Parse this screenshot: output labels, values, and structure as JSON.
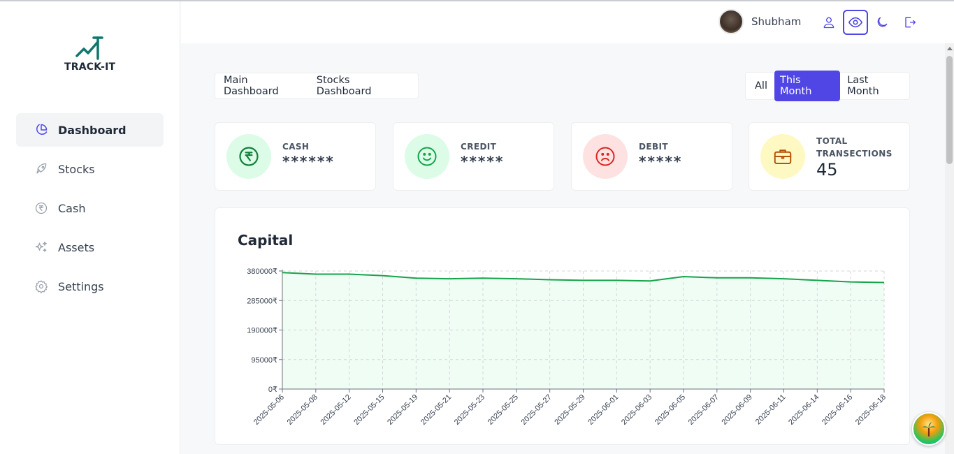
{
  "app": {
    "logo_text": "TRACK-IT"
  },
  "sidebar": {
    "items": [
      {
        "label": "Dashboard",
        "icon": "pie-chart-icon",
        "active": true
      },
      {
        "label": "Stocks",
        "icon": "rocket-icon",
        "active": false
      },
      {
        "label": "Cash",
        "icon": "rupee-circle-icon",
        "active": false
      },
      {
        "label": "Assets",
        "icon": "sparkles-icon",
        "active": false
      },
      {
        "label": "Settings",
        "icon": "gear-icon",
        "active": false
      }
    ]
  },
  "header": {
    "username": "Shubham",
    "icons": [
      "user-icon",
      "eye-icon",
      "moon-icon",
      "logout-icon"
    ]
  },
  "dashboard_tabs": [
    "Main Dashboard",
    "Stocks Dashboard"
  ],
  "period_filters": {
    "options": [
      "All",
      "This Month",
      "Last Month"
    ],
    "selected": "This Month"
  },
  "stats": [
    {
      "title": "CASH",
      "value": "******",
      "icon": "rupee-icon",
      "bg": "#dcfce7",
      "fg": "#15803d"
    },
    {
      "title": "CREDIT",
      "value": "*****",
      "icon": "smile-icon",
      "bg": "#dcfce7",
      "fg": "#16a34a"
    },
    {
      "title": "DEBIT",
      "value": "*****",
      "icon": "frown-icon",
      "bg": "#fee2e2",
      "fg": "#dc2626"
    },
    {
      "title": "TOTAL TRANSECTIONS",
      "value": "45",
      "icon": "briefcase-icon",
      "bg": "#fef9c3",
      "fg": "#b45309"
    }
  ],
  "chart_data": {
    "type": "area",
    "title": "Capital",
    "x": [
      "2025-05-06",
      "2025-05-08",
      "2025-05-12",
      "2025-05-15",
      "2025-05-19",
      "2025-05-21",
      "2025-05-23",
      "2025-05-25",
      "2025-05-27",
      "2025-05-29",
      "2025-06-01",
      "2025-06-03",
      "2025-06-05",
      "2025-06-07",
      "2025-06-09",
      "2025-06-11",
      "2025-06-14",
      "2025-06-16",
      "2025-06-18"
    ],
    "series": [
      {
        "values": [
          375000,
          370000,
          370000,
          365000,
          357000,
          355000,
          357000,
          355000,
          352000,
          350000,
          350000,
          348000,
          362000,
          358000,
          358000,
          355000,
          350000,
          345000,
          343000
        ]
      }
    ],
    "y_ticks": [
      0,
      95000,
      190000,
      285000,
      380000
    ],
    "y_tick_labels": [
      "0₹",
      "95000₹",
      "190000₹",
      "285000₹",
      "380000₹"
    ],
    "ylim": [
      0,
      380000
    ],
    "grid": true,
    "line_color": "#16a34a",
    "fill_color": "#f0fdf4"
  },
  "accent": "#4f46e5"
}
